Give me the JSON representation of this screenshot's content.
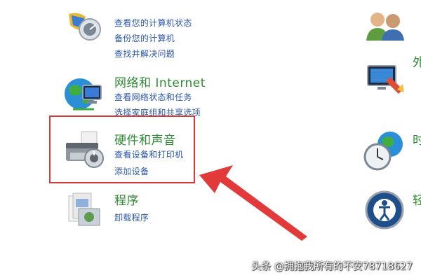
{
  "categories": {
    "system": {
      "links": [
        "查看您的计算机状态",
        "备份您的计算机",
        "查找并解决问题"
      ]
    },
    "network": {
      "title": "网络和 Internet",
      "links": [
        "查看网络状态和任务",
        "选择家庭组和共享选项"
      ]
    },
    "hardware": {
      "title": "硬件和声音",
      "links": [
        "查看设备和打印机",
        "添加设备"
      ]
    },
    "programs": {
      "title": "程序",
      "links": [
        "卸载程序"
      ]
    }
  },
  "right_column": {
    "partial_glyphs": [
      "外",
      "时",
      "轻"
    ]
  },
  "annotation": {
    "highlight_color": "#d33a3a",
    "arrow_color": "#e23a3a"
  },
  "watermark": "头条 @拥抱我所有的不安78718627",
  "icons": [
    "system-security-icon",
    "network-globe-icon",
    "hardware-printer-icon",
    "programs-icon",
    "user-accounts-icon",
    "appearance-icon",
    "clock-globe-icon",
    "ease-of-access-icon"
  ]
}
